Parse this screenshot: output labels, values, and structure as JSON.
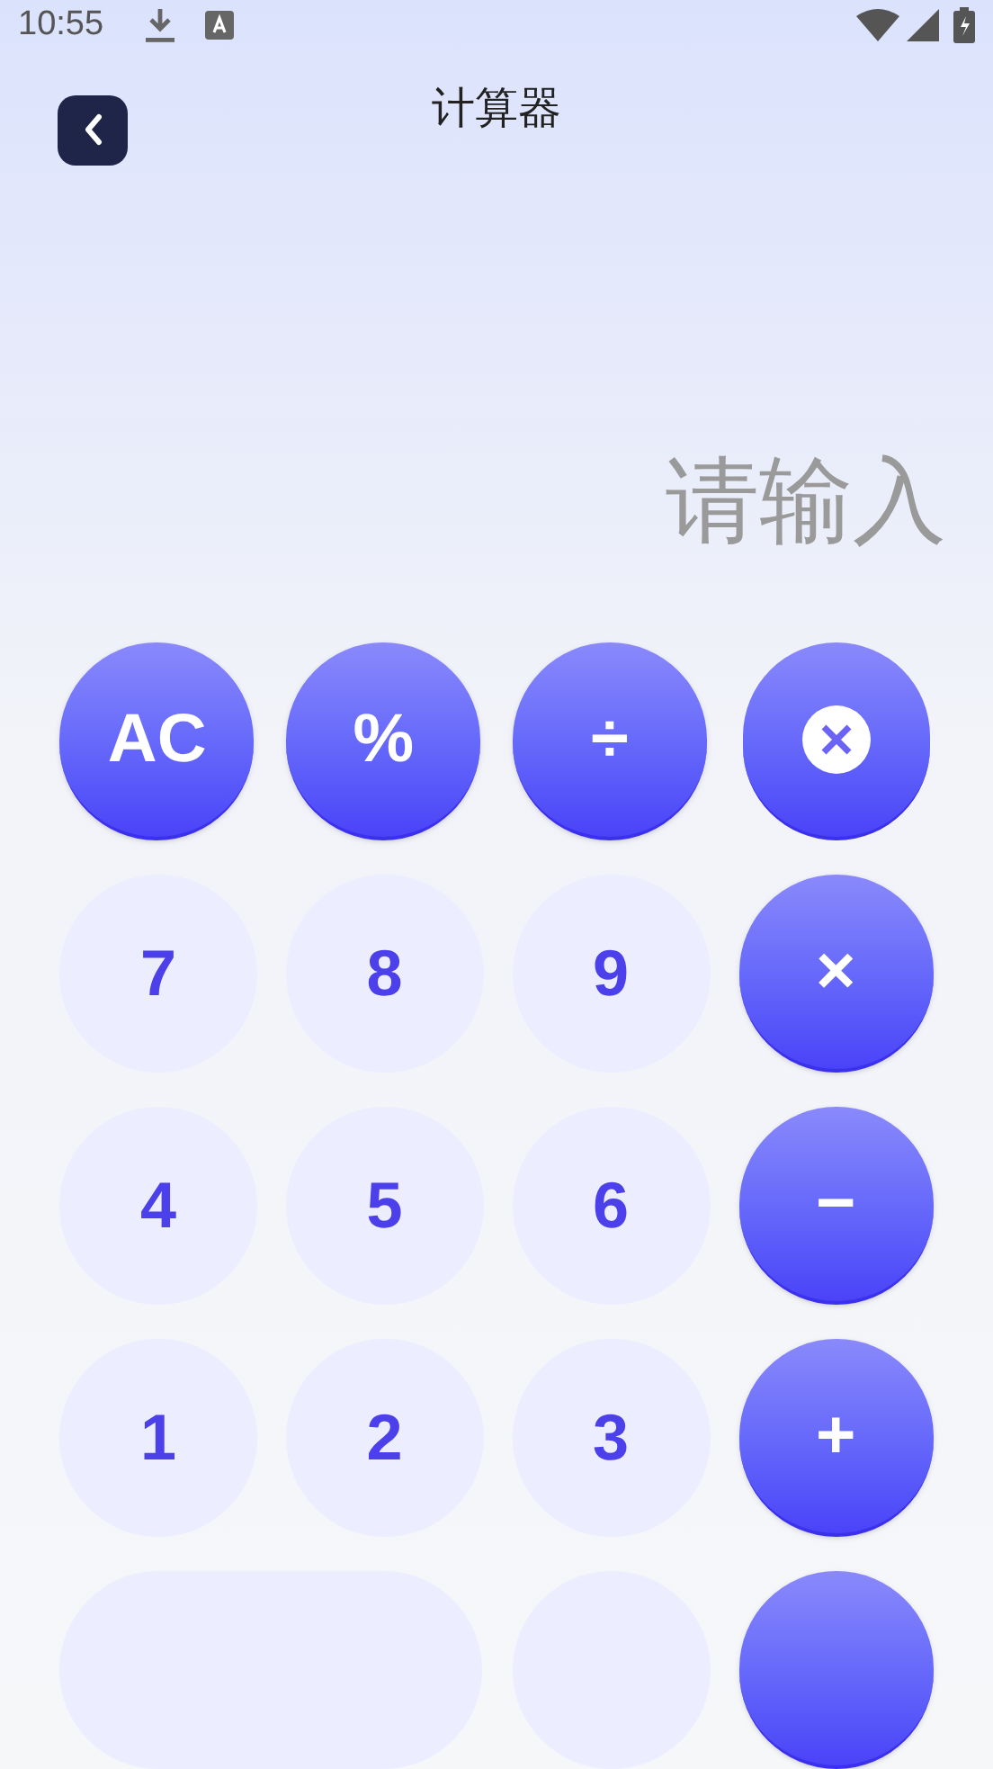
{
  "status_bar": {
    "time": "10:55"
  },
  "header": {
    "title": "计算器"
  },
  "display": {
    "placeholder": "请输入"
  },
  "keys": [
    {
      "kind": "action",
      "label": "AC"
    },
    {
      "kind": "action",
      "label": "%"
    },
    {
      "kind": "action",
      "label": "÷"
    },
    {
      "kind": "backspace"
    },
    {
      "kind": "digit",
      "label": "7"
    },
    {
      "kind": "digit",
      "label": "8"
    },
    {
      "kind": "digit",
      "label": "9"
    },
    {
      "kind": "action",
      "label": "×"
    },
    {
      "kind": "digit",
      "label": "4"
    },
    {
      "kind": "digit",
      "label": "5"
    },
    {
      "kind": "digit",
      "label": "6"
    },
    {
      "kind": "action",
      "label": "−"
    },
    {
      "kind": "digit",
      "label": "1"
    },
    {
      "kind": "digit",
      "label": "2"
    },
    {
      "kind": "digit",
      "label": "3"
    },
    {
      "kind": "action",
      "label": "+"
    },
    {
      "kind": "wide"
    },
    {
      "kind": "digit"
    },
    {
      "kind": "action"
    }
  ]
}
